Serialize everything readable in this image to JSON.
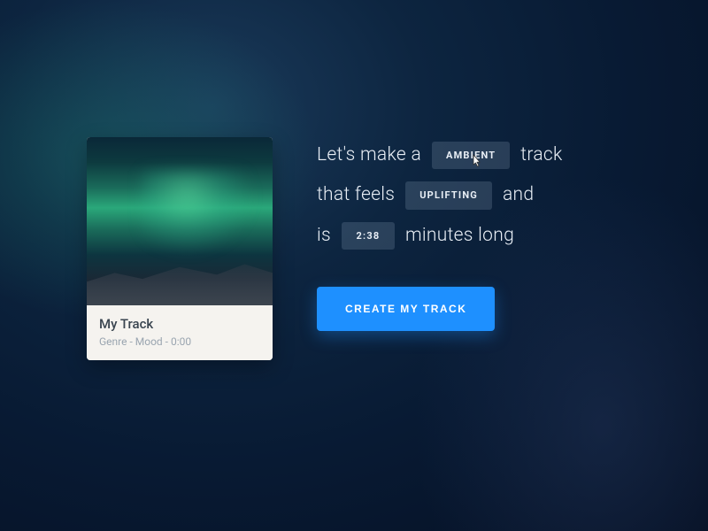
{
  "card": {
    "title": "My Track",
    "meta": "Genre - Mood - 0:00"
  },
  "builder": {
    "line1_a": "Let's make a",
    "genre": "AMBIENT",
    "line1_b": "track",
    "line2_a": "that feels",
    "mood": "UPLIFTING",
    "line2_b": "and",
    "line3_a": "is",
    "duration": "2:38",
    "line3_b": "minutes long"
  },
  "cta": {
    "label": "CREATE MY TRACK"
  }
}
